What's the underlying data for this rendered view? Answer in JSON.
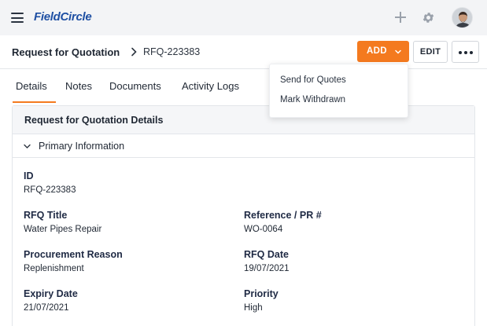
{
  "app": {
    "logo_text": "FieldCircle"
  },
  "topbar": {
    "icons": [
      "menu-icon",
      "plus-icon",
      "gear-icon",
      "avatar"
    ]
  },
  "header": {
    "breadcrumb_title": "Request for Quotation",
    "breadcrumb_id": "RFQ-223383",
    "add_label": "ADD",
    "edit_label": "EDIT",
    "accent_color": "#f47a1f"
  },
  "tabs": [
    {
      "label": "Details",
      "active": true
    },
    {
      "label": "Notes",
      "active": false
    },
    {
      "label": "Documents",
      "active": false
    },
    {
      "label": "Activity Logs",
      "active": false
    }
  ],
  "dropdown": {
    "items": [
      "Send for Quotes",
      "Mark Withdrawn"
    ]
  },
  "card": {
    "title": "Request for Quotation Details",
    "section_title": "Primary Information",
    "fields": {
      "id": {
        "label": "ID",
        "value": "RFQ-223383"
      },
      "rfq_title": {
        "label": "RFQ Title",
        "value": "Water Pipes Repair"
      },
      "reference": {
        "label": "Reference / PR #",
        "value": "WO-0064"
      },
      "procurement_reason": {
        "label": "Procurement Reason",
        "value": "Replenishment"
      },
      "rfq_date": {
        "label": "RFQ Date",
        "value": "19/07/2021"
      },
      "expiry_date": {
        "label": "Expiry Date",
        "value": "21/07/2021"
      },
      "priority": {
        "label": "Priority",
        "value": "High"
      }
    }
  }
}
